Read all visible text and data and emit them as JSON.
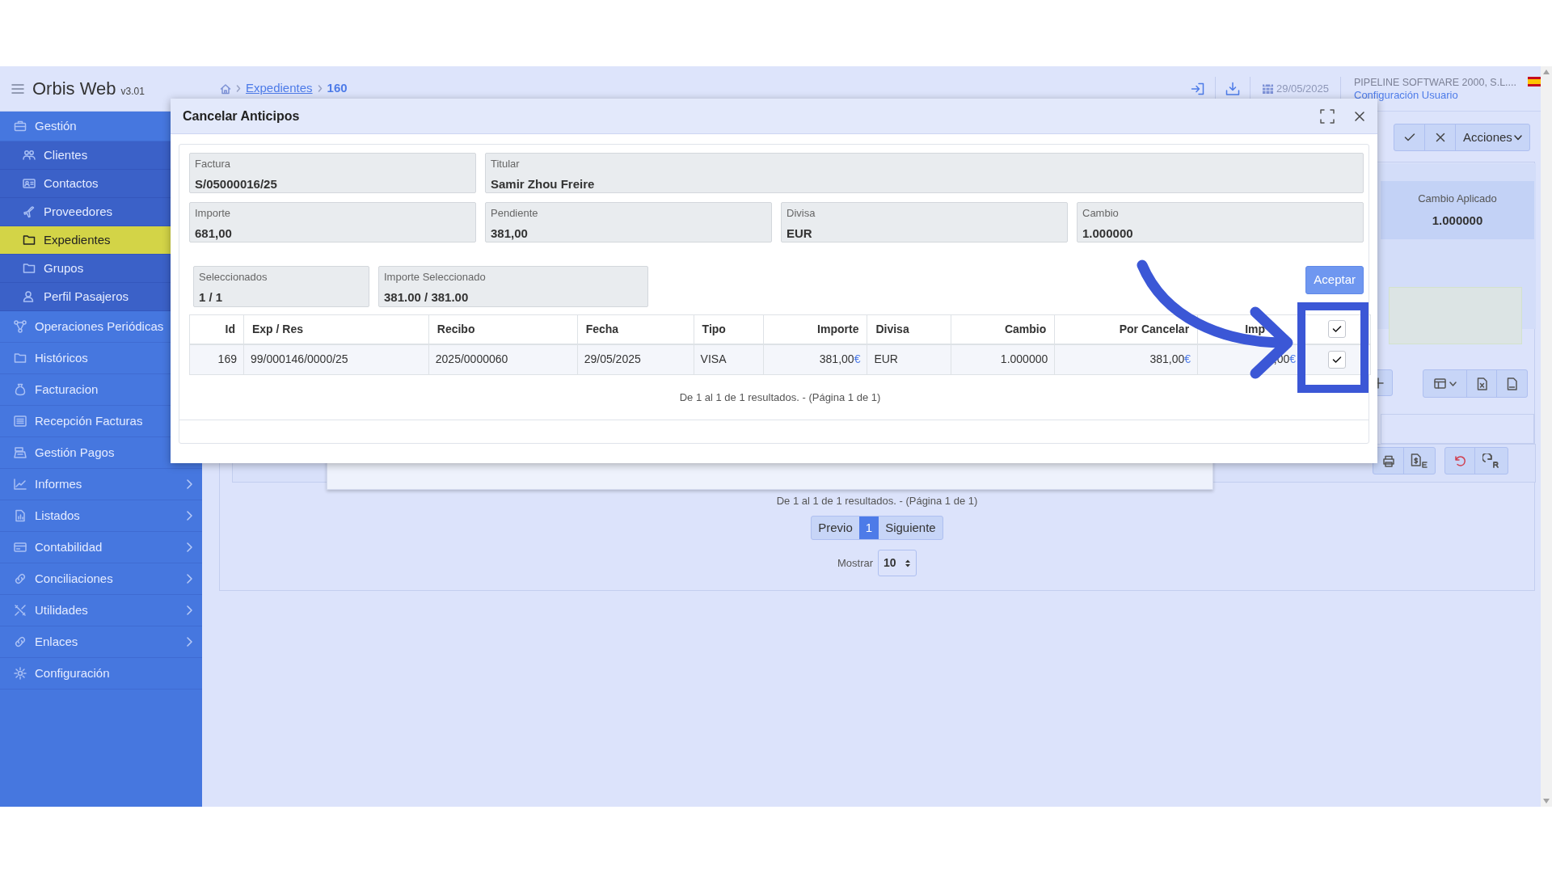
{
  "app": {
    "title": "Orbis Web",
    "version": "v3.01"
  },
  "breadcrumb": [
    {
      "label": "Expedientes",
      "link": true
    },
    {
      "label": "160",
      "link": false
    }
  ],
  "header": {
    "date": "29/05/2025",
    "company": "PIPELINE SOFTWARE 2000, S.L....",
    "user_link": "Configuración Usuario"
  },
  "sidebar": {
    "items": [
      {
        "label": "Gestión",
        "submenu": false,
        "children": [
          {
            "label": "Clientes",
            "selected": false
          },
          {
            "label": "Contactos",
            "selected": false
          },
          {
            "label": "Proveedores",
            "selected": false
          },
          {
            "label": "Expedientes",
            "selected": true
          },
          {
            "label": "Grupos",
            "selected": false
          },
          {
            "label": "Perfil Pasajeros",
            "selected": false
          }
        ]
      },
      {
        "label": "Operaciones Periódicas",
        "submenu": false
      },
      {
        "label": "Históricos",
        "submenu": false
      },
      {
        "label": "Facturacion",
        "submenu": false
      },
      {
        "label": "Recepción Facturas",
        "submenu": false
      },
      {
        "label": "Gestión Pagos",
        "submenu": false
      },
      {
        "label": "Informes",
        "submenu": true
      },
      {
        "label": "Listados",
        "submenu": true
      },
      {
        "label": "Contabilidad",
        "submenu": true
      },
      {
        "label": "Conciliaciones",
        "submenu": true
      },
      {
        "label": "Utilidades",
        "submenu": true
      },
      {
        "label": "Enlaces",
        "submenu": true
      },
      {
        "label": "Configuración",
        "submenu": false
      }
    ]
  },
  "background_form": {
    "actions_menu": "Acciones",
    "cambio_aplicado": {
      "label": "Cambio Aplicado",
      "value": "1.000000"
    },
    "pagination": {
      "summary": "De 1 al 1 de 1 resultados. - (Página 1 de 1)",
      "pages": [
        {
          "label": "Previo",
          "selected": false
        },
        {
          "label": "1",
          "selected": true
        },
        {
          "label": "Siguiente",
          "selected": false
        }
      ],
      "show_label": "Mostrar",
      "page_size": "10"
    }
  },
  "dialog": {
    "title": "Cancelar Anticipos",
    "fields": [
      {
        "label": "Factura",
        "value": "S/05000016/25",
        "wide": false
      },
      {
        "label": "Titular",
        "value": "Samir Zhou Freire",
        "wide": true
      },
      {
        "label": "Importe",
        "value": "681,00",
        "wide": false
      },
      {
        "label": "Pendiente",
        "value": "381,00",
        "wide": false
      },
      {
        "label": "Divisa",
        "value": "EUR",
        "wide": false
      },
      {
        "label": "Cambio",
        "value": "1.000000",
        "wide": false
      }
    ],
    "summary": [
      {
        "label": "Seleccionados",
        "value": "1 / 1"
      },
      {
        "label": "Importe Seleccionado",
        "value": "381.00 / 381.00"
      }
    ],
    "accept_button": "Aceptar",
    "table": {
      "columns": [
        {
          "label": "Id",
          "kind": "number"
        },
        {
          "label": "Exp / Res",
          "kind": "text"
        },
        {
          "label": "Recibo",
          "kind": "text"
        },
        {
          "label": "Fecha",
          "kind": "text"
        },
        {
          "label": "Tipo",
          "kind": "text"
        },
        {
          "label": "Importe",
          "kind": "number"
        },
        {
          "label": "Divisa",
          "kind": "text"
        },
        {
          "label": "Cambio",
          "kind": "number"
        },
        {
          "label": "Por Cancelar",
          "kind": "number"
        },
        {
          "label": "Imp",
          "kind": "number"
        }
      ],
      "header_checked": true,
      "rows": [
        {
          "checked": true,
          "cells": [
            {
              "value": "169"
            },
            {
              "value": "99/000146/0000/25"
            },
            {
              "value": "2025/0000060"
            },
            {
              "value": "29/05/2025"
            },
            {
              "value": "VISA"
            },
            {
              "value": "381,00",
              "unit": "€"
            },
            {
              "value": "EUR"
            },
            {
              "value": "1.000000"
            },
            {
              "value": "381,00",
              "unit": "€"
            },
            {
              "value": ",00",
              "unit": "€"
            }
          ]
        }
      ]
    },
    "pagination_summary": "De 1 al 1 de 1 resultados. - (Página 1 de 1)"
  }
}
